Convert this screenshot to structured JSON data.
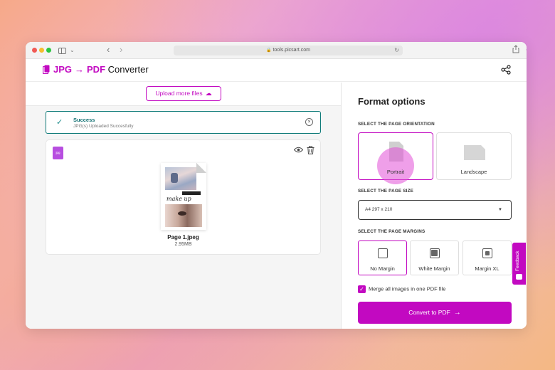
{
  "browser": {
    "url": "tools.picsart.com"
  },
  "app": {
    "title_from": "JPG",
    "title_arrow": "→",
    "title_to": "PDF",
    "title_rest": "Converter"
  },
  "upload": {
    "button_label": "Upload more files"
  },
  "notification": {
    "title": "Success",
    "message": "JPG(s) Uploaded Succesfully"
  },
  "file": {
    "badge": "jpg",
    "thumb_script": "make up",
    "name": "Page 1.jpeg",
    "size": "2.95MB"
  },
  "format": {
    "title": "Format options",
    "orientation_label": "SELECT THE PAGE ORIENTATION",
    "orientations": [
      {
        "label": "Portrait",
        "selected": true
      },
      {
        "label": "Landscape",
        "selected": false
      }
    ],
    "size_label": "SELECT THE PAGE SIZE",
    "size_value": "A4 297 x 210",
    "margins_label": "SELECT THE PAGE MARGINS",
    "margins": [
      {
        "label": "No Margin",
        "selected": true
      },
      {
        "label": "White Margin",
        "selected": false
      },
      {
        "label": "Margin XL",
        "selected": false
      }
    ],
    "merge_label": "Merge all images in one PDF file",
    "merge_checked": true,
    "convert_label": "Convert to PDF"
  },
  "feedback": {
    "label": "Feedback"
  },
  "colors": {
    "accent": "#c209c1",
    "success_border": "#0e7a78"
  }
}
